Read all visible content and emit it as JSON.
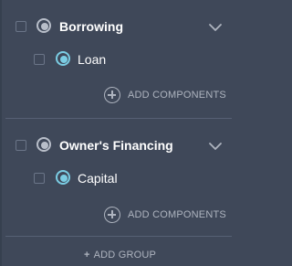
{
  "groups": [
    {
      "title": "Borrowing",
      "items": [
        {
          "label": "Loan"
        }
      ],
      "add_components_label": "ADD COMPONENTS"
    },
    {
      "title": "Owner's Financing",
      "items": [
        {
          "label": "Capital"
        }
      ],
      "add_components_label": "ADD COMPONENTS"
    }
  ],
  "add_group": {
    "symbol": "+",
    "label": "ADD GROUP"
  },
  "colors": {
    "background": "#3f4859",
    "group_radio": "#b8bec9",
    "item_radio": "#7bcde3",
    "muted_text": "#aeb4bf",
    "text": "#ffffff"
  },
  "icons": {
    "collapse": "chevron-down-icon",
    "add": "plus-circle-icon"
  }
}
